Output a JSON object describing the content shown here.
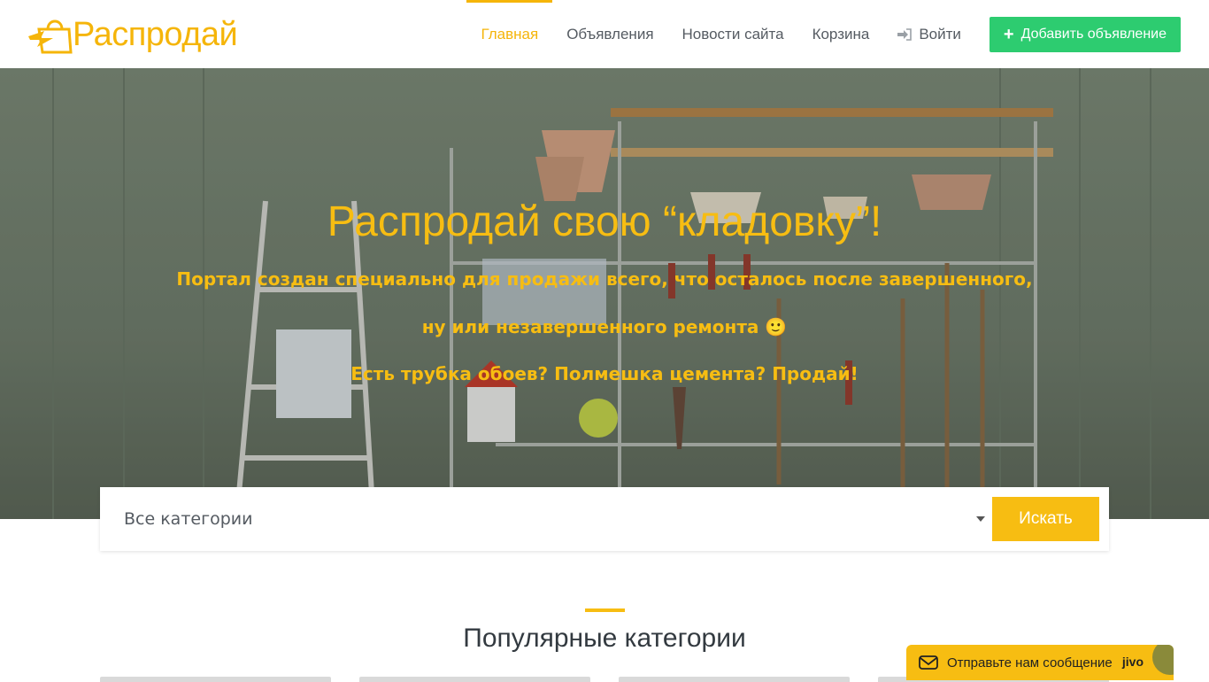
{
  "header": {
    "logo_text": "Распродай",
    "nav": [
      {
        "label": "Главная",
        "active": true
      },
      {
        "label": "Объявления",
        "active": false
      },
      {
        "label": "Новости сайта",
        "active": false
      },
      {
        "label": "Корзина",
        "active": false
      },
      {
        "label": "Войти",
        "active": false,
        "icon": "sign-in-icon"
      }
    ],
    "add_button": {
      "label": "Добавить объявление",
      "icon": "plus-icon"
    }
  },
  "hero": {
    "title": "Распродай свою “кладовку”!",
    "line1": "Портал создан специально для продажи всего, что осталось после завершенного,",
    "line2": "ну или незавершенного ремонта 🙂",
    "line3": "Есть трубка обоев? Полмешка цемента? Продай!"
  },
  "search": {
    "category_value": "Все категории",
    "button_label": "Искать"
  },
  "section": {
    "title": "Популярные категории"
  },
  "chat": {
    "label": "Отправьте нам сообщение",
    "brand": "jivo"
  },
  "colors": {
    "accent": "#f7bd12",
    "green": "#2dcc70",
    "nav_text": "#555b62"
  }
}
